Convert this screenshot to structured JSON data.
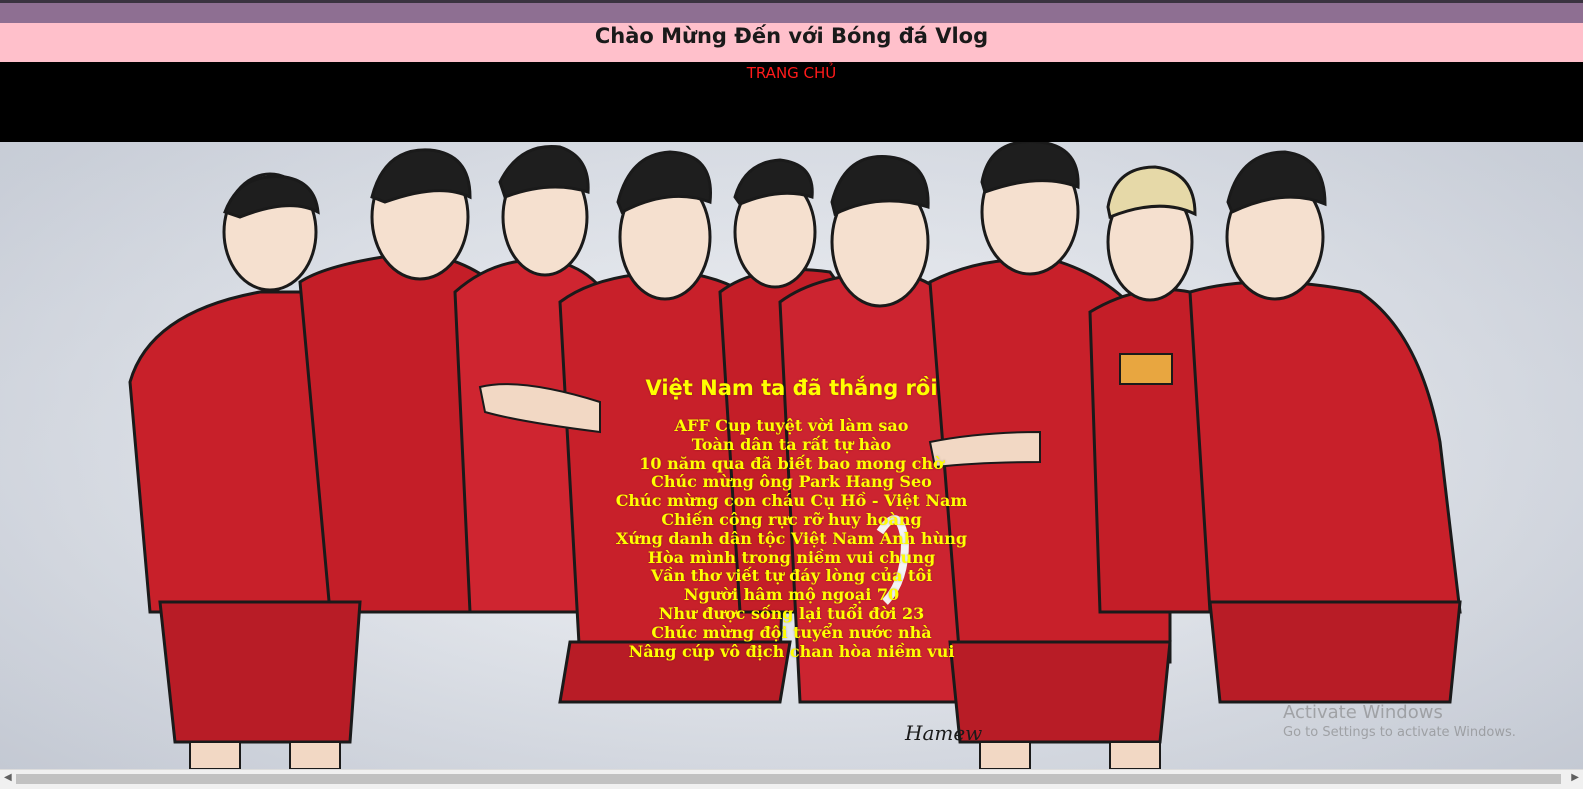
{
  "header": {
    "title": "Chào Mừng Đến với Bóng đá Vlog"
  },
  "nav": {
    "home_label": "TRANG CHỦ"
  },
  "poem": {
    "title": "Việt Nam ta đã thắng rồi",
    "lines": [
      "AFF Cup tuyệt vời làm sao",
      "Toàn dân ta rất tự hào",
      "10 năm qua đã biết bao mong chờ",
      "Chúc mừng ông Park Hang Seo",
      "Chúc mừng con cháu Cụ Hồ - Việt Nam",
      "Chiến công rực rỡ huy hoàng",
      "Xứng danh dân tộc Việt Nam Anh hùng",
      "Hòa mình trong niềm vui chung",
      "Vần thơ viết tự đáy lòng của tôi",
      "Người hâm mộ ngoại 70",
      "Như được sống lại tuổi đời 23",
      "Chúc mừng đội tuyển nước nhà",
      "Nâng cúp vô địch chan hòa niềm vui"
    ]
  },
  "hero": {
    "signature": "Hamew"
  },
  "watermark": {
    "title": "Activate Windows",
    "subtitle": "Go to Settings to activate Windows."
  },
  "colors": {
    "header_bg": "#ffc0cb",
    "nav_bg": "#000000",
    "nav_link": "#ff1a1a",
    "poem_text": "#ffff00",
    "jersey": "#c8202a"
  }
}
